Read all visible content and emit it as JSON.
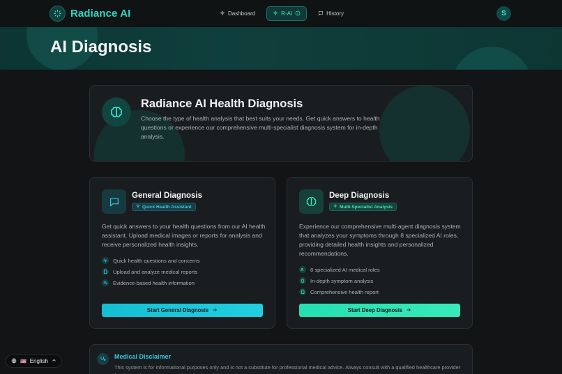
{
  "app": {
    "brand_name": "Radiance AI",
    "colors": {
      "accent": "#2fd6c2",
      "cyan": "#21cfe0",
      "green": "#37eab9",
      "background": "#121416"
    }
  },
  "nav": {
    "items": [
      {
        "label": "Dashboard",
        "icon": "sparkle-icon",
        "active": false
      },
      {
        "label": "R-AI",
        "icon": "sparkle-icon",
        "active": true
      },
      {
        "label": "History",
        "icon": "chat-icon",
        "active": false
      }
    ],
    "avatar_initial": "S"
  },
  "hero": {
    "title": "AI Diagnosis"
  },
  "intro": {
    "title": "Radiance AI Health Diagnosis",
    "description": "Choose the type of health analysis that best suits your needs. Get quick answers to health questions or experience our comprehensive multi-specialist diagnosis system for in-depth analysis."
  },
  "general": {
    "title": "General Diagnosis",
    "badge": "Quick Health Assistant",
    "description": "Get quick answers to your health questions from our AI health assistant. Upload medical images or reports for analysis and receive personalized health insights.",
    "features": [
      "Quick health questions and concerns",
      "Upload and analyze medical reports",
      "Evidence-based health information"
    ],
    "button": "Start General Diagnosis"
  },
  "deep": {
    "title": "Deep Diagnosis",
    "badge": "Multi-Specialist Analysis",
    "description": "Experience our comprehensive multi-agent diagnosis system that analyzes your symptoms through 8 specialized AI roles, providing detailed health insights and personalized recommendations.",
    "features": [
      "8 specialized AI medical roles",
      "In-depth symptom analysis",
      "Comprehensive health report"
    ],
    "button": "Start Deep Diagnosis"
  },
  "disclaimer": {
    "title": "Medical Disclaimer",
    "text": "This system is for informational purposes only and is not a substitute for professional medical advice. Always consult with a qualified healthcare provider for diagnosis and treatment of medical conditions."
  },
  "language": {
    "label": "English",
    "flag": "🇺🇸"
  }
}
